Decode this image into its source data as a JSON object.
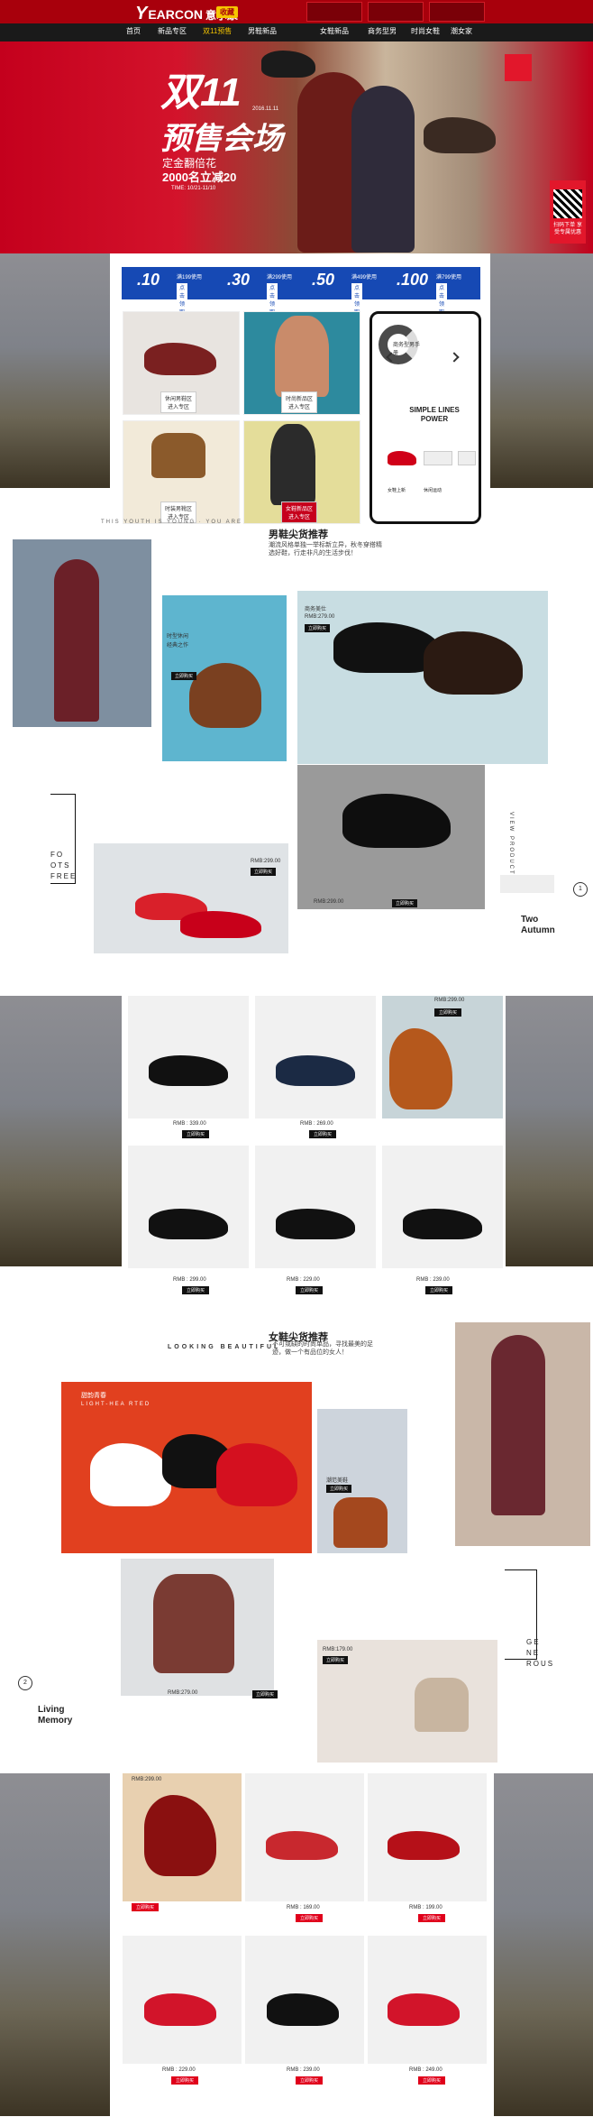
{
  "header": {
    "logo_text": "EARCON",
    "logo_cn": "意尔康",
    "fav_button": "收藏",
    "menu": [
      {
        "label": "首页"
      },
      {
        "label": "新品专区"
      },
      {
        "label": "双11预售"
      },
      {
        "label": "男鞋新品"
      },
      {
        "label": "女鞋新品"
      },
      {
        "label": "商务型男"
      },
      {
        "label": "时尚女鞋"
      },
      {
        "label": "潮女家"
      }
    ]
  },
  "hero": {
    "title_line1": "双11",
    "title_line2": "预售会场",
    "date": "2016.11.11",
    "sub1": "定金翻倍花",
    "sub2": "2000名立减20",
    "time": "TIME: 10/21-11/10",
    "side_text": "扫码下单 享受专属优惠"
  },
  "coupons": [
    {
      "value": ".10",
      "title": "满199使用",
      "btn": "点击领取"
    },
    {
      "value": ".30",
      "title": "满299使用",
      "btn": "点击领取"
    },
    {
      "value": ".50",
      "title": "满499使用",
      "btn": "点击领取"
    },
    {
      "value": ".100",
      "title": "满799使用",
      "btn": "点击领取"
    }
  ],
  "categories": [
    {
      "label": "休闲男鞋区",
      "btn": "进入专区"
    },
    {
      "label": "时尚新品区",
      "btn": "进入专区"
    },
    {
      "label": "时装男靴区",
      "btn": "进入专区"
    },
    {
      "label": "女鞋新品区",
      "btn": "进入专区"
    }
  ],
  "promo_panel": {
    "ring_label": "商务型男手册",
    "simple_text": "SIMPLE LINES POWER",
    "item_labels": [
      "女鞋上新",
      "休闲运动"
    ]
  },
  "men": {
    "tagline": "THIS YOUTH IS YOUNG · YOU ARE",
    "title": "男鞋尖货推荐",
    "subtitle": "潮流风格单独一举标新立异，秋冬穿搭精选好鞋，行走非凡的生活步伐！",
    "feature_boxes": [
      {
        "label": "时型休闲",
        "sub": "经典之作",
        "btn": "立即购买"
      },
      {
        "label": "商务美仕",
        "sub": "RMB:279.00",
        "btn": "立即购买"
      },
      {
        "label": "",
        "sub": "RMB:299.00",
        "btn": "立即购买"
      },
      {
        "label": "",
        "sub": "RMB:299.00",
        "btn": "立即购买"
      }
    ],
    "foots": "FO\nOTS\nFREE",
    "two_autumn": "Two\nAutumn",
    "num": "1",
    "vertical": "VIEW PRODUCT"
  },
  "men_grid": [
    {
      "price": "RMB : 339.00",
      "btn": "立即购买"
    },
    {
      "price": "RMB : 269.00",
      "btn": "立即购买"
    },
    {
      "price": "RMB:299.00",
      "btn": "立即购买"
    },
    {
      "price": "RMB : 299.00",
      "btn": "立即购买"
    },
    {
      "price": "RMB : 229.00",
      "btn": "立即购买"
    },
    {
      "price": "RMB : 239.00",
      "btn": "立即购买"
    }
  ],
  "women": {
    "tagline": "LOOKING BEAUTIFUL",
    "title": "女鞋尖货推荐",
    "subtitle": "不可或缺的时尚单品，寻找最美的足迹，做一个有品位的女人！",
    "hero_label": "甜韵青春",
    "hero_sub": "LIGHT-HEA RTED",
    "feature_boxes": [
      {
        "label": "潮范美鞋",
        "sub": "",
        "btn": "立即购买"
      },
      {
        "label": "",
        "sub": "RMB:279.00",
        "btn": "立即购买"
      },
      {
        "label": "",
        "sub": "RMB:179.00",
        "btn": "立即购买"
      }
    ],
    "living": "Living\nMemory",
    "num": "2",
    "gensrous": "GE\nNE\nROUS"
  },
  "women_grid": [
    {
      "price": "RMB:299.00",
      "btn": "立即购买"
    },
    {
      "price": "RMB : 169.00",
      "btn": "立即购买"
    },
    {
      "price": "RMB : 199.00",
      "btn": "立即购买"
    },
    {
      "price": "RMB : 229.00",
      "btn": "立即购买"
    },
    {
      "price": "RMB : 239.00",
      "btn": "立即购买"
    },
    {
      "price": "RMB : 249.00",
      "btn": "立即购买"
    }
  ],
  "colors": {
    "brand_red": "#a8000c",
    "accent_blue": "#1649b4",
    "accent_yellow": "#f6c600"
  }
}
